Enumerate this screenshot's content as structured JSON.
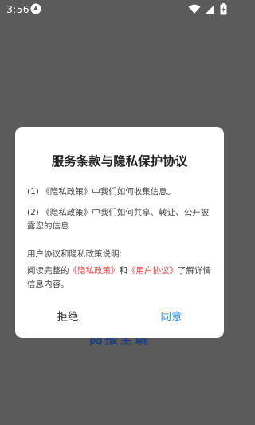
{
  "status_bar": {
    "time": "3:56"
  },
  "background": {
    "partial_text": "阅报全端"
  },
  "dialog": {
    "title": "服务条款与隐私保护协议",
    "items": [
      {
        "prefix": "(1) ",
        "policy": "《隐私政策》",
        "text": "中我们如何收集信息。"
      },
      {
        "prefix": "(2) ",
        "policy": "《隐私政策》",
        "text": "中我们如何共享、转让、公开披露您的信息"
      }
    ],
    "explain_title": "用户协议和隐私政策说明:",
    "explain_prefix": "阅读完整的",
    "explain_link1": "《隐私政策》",
    "explain_middle": "和",
    "explain_link2": "《用户协议》",
    "explain_suffix": "了解详情信息内容。",
    "reject_label": "拒绝",
    "agree_label": "同意"
  },
  "colors": {
    "overlay": "#5b5b5b",
    "link": "#e0443e",
    "agree": "#2b8fe0"
  }
}
